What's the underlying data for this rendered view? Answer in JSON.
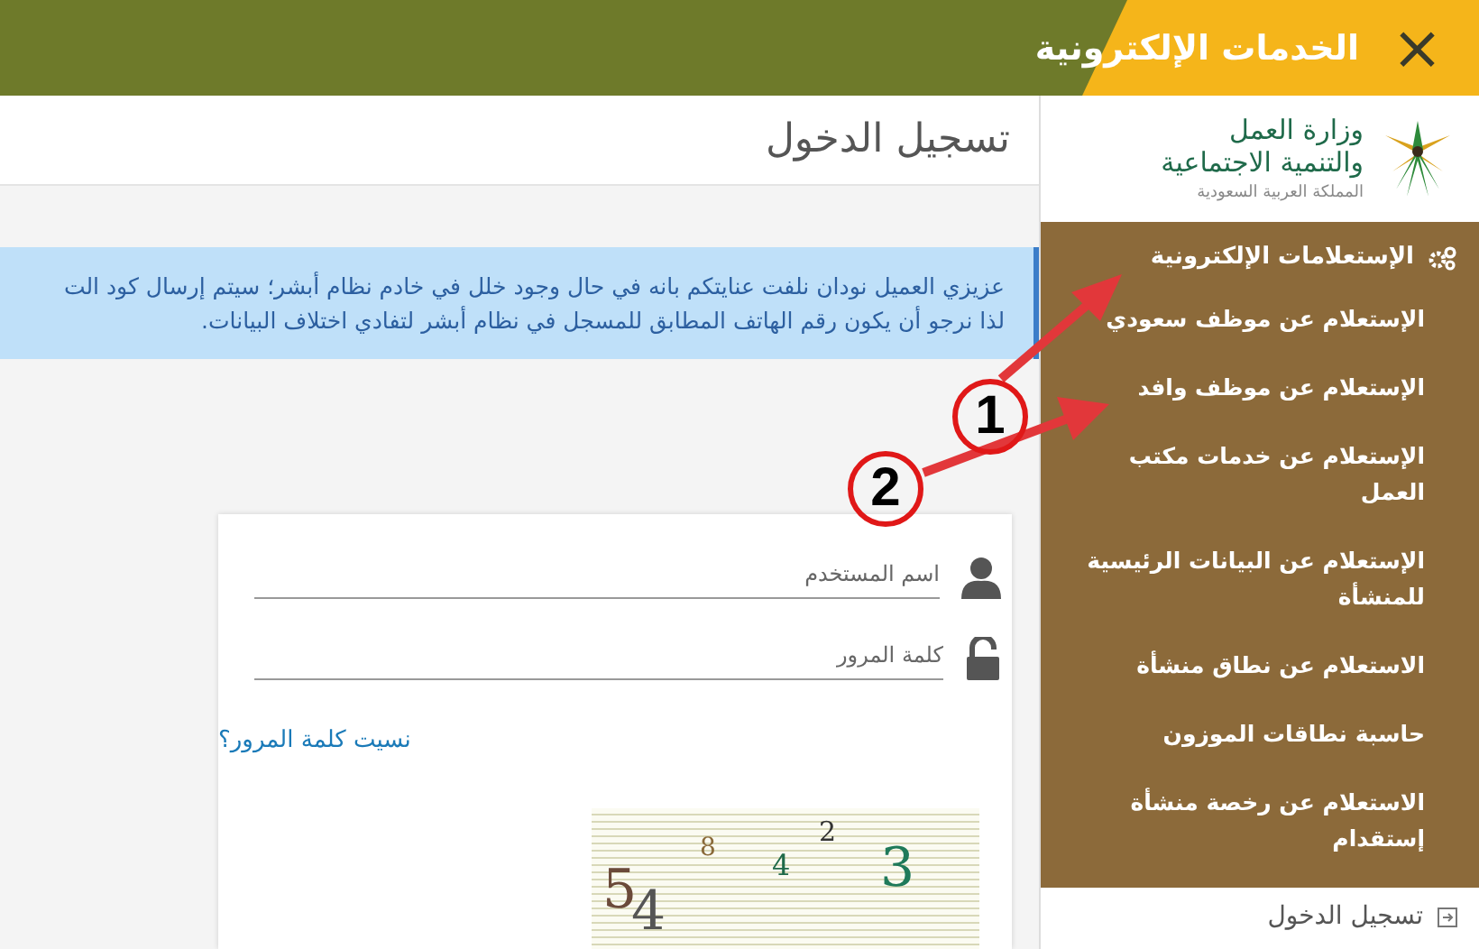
{
  "header": {
    "close": "×",
    "title": "الخدمات الإلكترونية"
  },
  "sidebar": {
    "logo": {
      "name_line_1": "وزارة العمل",
      "name_line_2": "والتنمية الاجتماعية",
      "country": "المملكة العربية السعودية"
    },
    "menu": {
      "title": "الإستعلامات الإلكترونية",
      "items": [
        {
          "label": "الإستعلام عن موظف سعودي"
        },
        {
          "label": "الإستعلام عن موظف وافد"
        },
        {
          "label": "الإستعلام عن خدمات مكتب العمل"
        },
        {
          "label": "الإستعلام عن البيانات الرئيسية للمنشأة"
        },
        {
          "label": "الاستعلام عن نطاق منشأة"
        },
        {
          "label": "حاسبة نطاقات الموزون"
        },
        {
          "label": "الاستعلام عن رخصة منشأة إستقدام"
        }
      ]
    },
    "bottom_item": "تسجيل الدخول"
  },
  "page": {
    "title": "تسجيل الدخول",
    "alert": [
      "عزيزي العميل نودان نلفت عنايتكم بانه في حال وجود خلل في خادم نظام أبشر؛ سيتم إرسال كود الت",
      "لذا نرجو أن يكون رقم الهاتف المطابق للمسجل في نظام أبشر لتفادي اختلاف البيانات."
    ],
    "form": {
      "username": {
        "placeholder": "اسم المستخدم"
      },
      "password": {
        "placeholder": "كلمة المرور"
      },
      "forgot_link": "نسيت كلمة المرور؟",
      "captcha": [
        {
          "char": "5",
          "color": "#6b4a3a"
        },
        {
          "char": "4",
          "color": "#555555"
        },
        {
          "char": "8",
          "color": "#8a6a3a"
        },
        {
          "char": "4",
          "color": "#1f6a4a"
        },
        {
          "char": "2",
          "color": "#333333"
        },
        {
          "char": "3",
          "color": "#1f7a5a"
        }
      ]
    }
  },
  "annotations": [
    {
      "label": "1"
    },
    {
      "label": "2"
    }
  ]
}
